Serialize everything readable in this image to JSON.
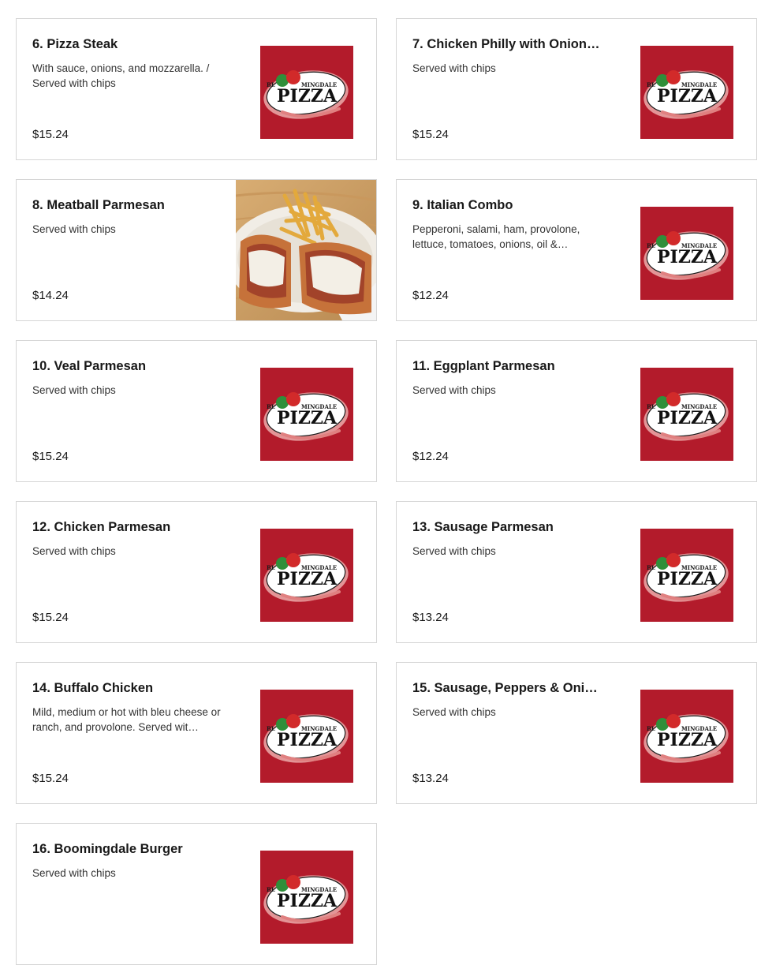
{
  "brand_logo": {
    "text_top": "BLOOMINGDALE",
    "text_bottom": "PIZZA",
    "background_color": "#b31b2b"
  },
  "menu_items": [
    {
      "name": "6. Pizza Steak",
      "description": "With sauce, onions, and mozzarella. / Served with chips",
      "price": "$15.24",
      "image": "logo"
    },
    {
      "name": "7. Chicken Philly with Onions…",
      "description": "Served with chips",
      "price": "$15.24",
      "image": "logo"
    },
    {
      "name": "8. Meatball Parmesan",
      "description": "Served with chips",
      "price": "$14.24",
      "image": "photo"
    },
    {
      "name": "9. Italian Combo",
      "description": "Pepperoni, salami, ham, provolone, lettuce, tomatoes, onions, oil &…",
      "price": "$12.24",
      "image": "logo"
    },
    {
      "name": "10. Veal Parmesan",
      "description": "Served with chips",
      "price": "$15.24",
      "image": "logo"
    },
    {
      "name": "11. Eggplant Parmesan",
      "description": "Served with chips",
      "price": "$12.24",
      "image": "logo"
    },
    {
      "name": "12. Chicken Parmesan",
      "description": "Served with chips",
      "price": "$15.24",
      "image": "logo"
    },
    {
      "name": "13. Sausage Parmesan",
      "description": "Served with chips",
      "price": "$13.24",
      "image": "logo"
    },
    {
      "name": "14. Buffalo Chicken",
      "description": "Mild, medium or hot with bleu cheese or ranch, and provolone. Served wit…",
      "price": "$15.24",
      "image": "logo"
    },
    {
      "name": "15. Sausage, Peppers & Onio…",
      "description": "Served with chips",
      "price": "$13.24",
      "image": "logo"
    },
    {
      "name": "16. Boomingdale Burger",
      "description": "Served with chips",
      "price": "",
      "image": "logo"
    }
  ]
}
